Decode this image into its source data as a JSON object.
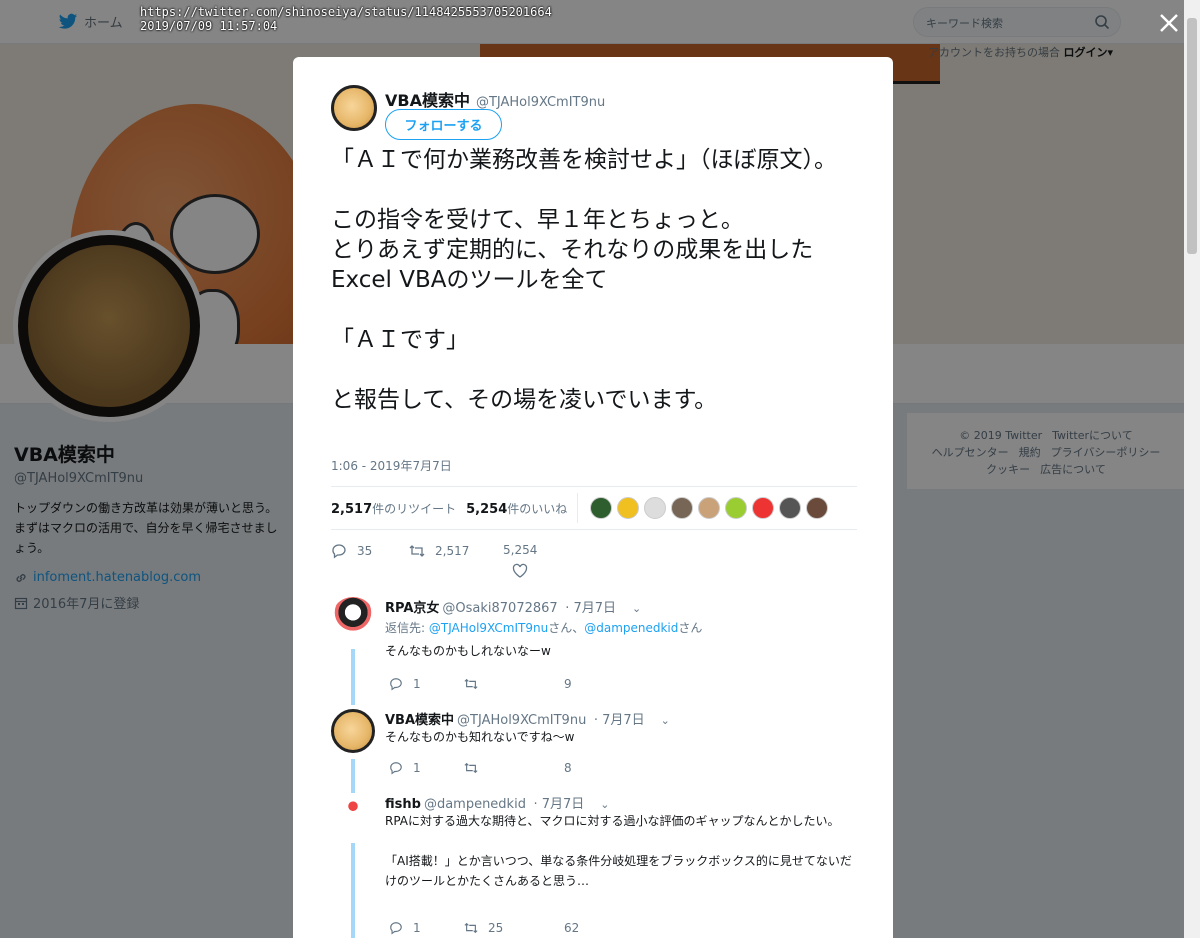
{
  "url_overlay": {
    "url": "https://twitter.com/shinoseiya/status/1148425553705201664",
    "datetime": "2019/07/09 11:57:04"
  },
  "topnav": {
    "home_label": "ホーム",
    "search_placeholder": "キーワード検索",
    "login_prompt": "アカウントをお持ちの場合",
    "login_label": "ログイン▾"
  },
  "profile": {
    "name": "VBA模索中",
    "handle": "@TJAHol9XCmIT9nu",
    "bio": "トップダウンの働き方改革は効果が薄いと思う。まずはマクロの活用で、自分を早く帰宅させましょう。",
    "link": "infoment.hatenablog.com",
    "joined": "2016年7月に登録"
  },
  "footer": {
    "copyright": "© 2019 Twitter",
    "about": "Twitterについて",
    "help": "ヘルプセンター",
    "terms": "規約",
    "privacy": "プライバシーポリシー",
    "cookies": "クッキー",
    "ads": "広告について"
  },
  "tweet": {
    "author_name": "VBA模索中",
    "author_handle": "@TJAHol9XCmIT9nu",
    "follow_label": "フォローする",
    "text": "「ＡＩで何か業務改善を検討せよ」（ほぼ原文）。\n\nこの指令を受けて、早１年とちょっと。\nとりあえず定期的に、それなりの成果を出したExcel VBAのツールを全て\n\n「ＡＩです」\n\nと報告して、その場を凌いでいます。",
    "timestamp": "1:06 - 2019年7月7日",
    "retweets": "2,517",
    "retweets_label": "件のリツイート",
    "likes": "5,254",
    "likes_label": "件のいいね",
    "reply_count": "35",
    "retweet_count": "2,517",
    "like_count": "5,254"
  },
  "replies": [
    {
      "name": "RPA京女",
      "handle": "@Osaki87072867",
      "date": "· 7月7日",
      "reply_to_prefix": "返信先: ",
      "reply_to_1": "@TJAHol9XCmIT9nu",
      "reply_to_mid": "さん、",
      "reply_to_2": "@dampenedkid",
      "reply_to_suffix": "さん",
      "text": "そんなものかもしれないなーw",
      "replies": "1",
      "likes": "9"
    },
    {
      "name": "VBA模索中",
      "handle": "@TJAHol9XCmIT9nu",
      "date": "· 7月7日",
      "text": "そんなものかも知れないですね～w",
      "replies": "1",
      "likes": "8"
    },
    {
      "name": "fishb",
      "handle": "@dampenedkid",
      "date": "· 7月7日",
      "text": "RPAに対する過大な期待と、マクロに対する過小な評価のギャップなんとかしたい。\n\n「AI搭載！」とか言いつつ、単なる条件分岐処理をブラックボックス的に見せてないだけのツールとかたくさんあると思う…",
      "replies": "1",
      "retweets": "25",
      "likes": "62"
    }
  ],
  "icons": [
    "twitter-bird-icon",
    "search-icon",
    "close-icon",
    "link-icon",
    "calendar-icon",
    "reply-icon",
    "retweet-icon",
    "heart-icon",
    "chevron-down-icon"
  ],
  "colors": {
    "accent": "#1da1f2",
    "thread_line": "#a5d7f8",
    "text_secondary": "#657786"
  }
}
